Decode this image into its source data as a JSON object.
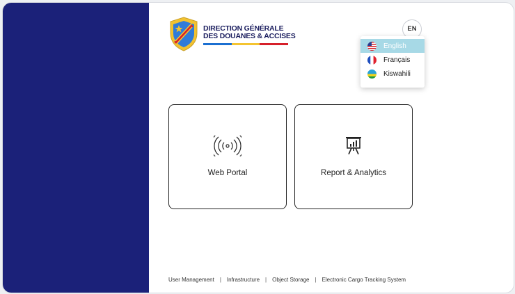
{
  "brand": {
    "line1": "DIRECTION GÉNÉRALE",
    "line2": "DES DOUANES & ACCISES",
    "stripe_colors": [
      "#1b6fd1",
      "#f4c430",
      "#d6202a"
    ]
  },
  "language": {
    "current": "EN",
    "options": [
      {
        "label": "English",
        "flag": "us-flag",
        "selected": true
      },
      {
        "label": "Français",
        "flag": "fr-flag",
        "selected": false
      },
      {
        "label": "Kiswahili",
        "flag": "rw-flag",
        "selected": false
      }
    ]
  },
  "cards": [
    {
      "label": "Web Portal",
      "icon": "wireless-signal-icon"
    },
    {
      "label": "Report & Analytics",
      "icon": "presentation-chart-icon"
    }
  ],
  "footer": {
    "links": [
      "User Management",
      "Infrastructure",
      "Object Storage",
      "Electronic Cargo Tracking System"
    ],
    "separator": "|"
  },
  "colors": {
    "sidebar": "#1b2179",
    "selected_language": "#a7d9e6"
  }
}
